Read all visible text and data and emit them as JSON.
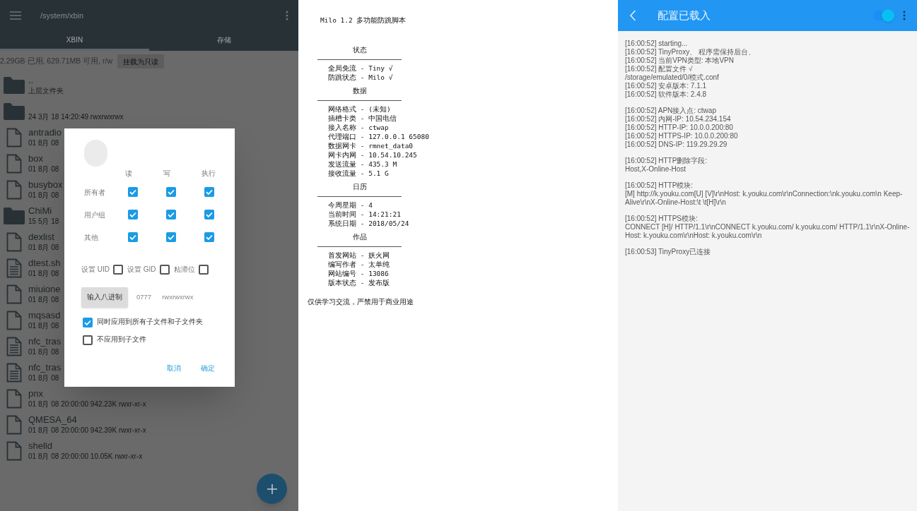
{
  "file_manager": {
    "path": "/system/xbin",
    "tabs": [
      {
        "label": "XBIN",
        "selected": true
      },
      {
        "label": "存储",
        "selected": false
      }
    ],
    "storage_info": "2.29GB 已用, 629.71MB 可用, r/w",
    "mount_button": "挂载为只读",
    "files": [
      {
        "kind": "folder",
        "name": "..",
        "meta": "上层文件夹"
      },
      {
        "kind": "folder",
        "meta": "24 3月 18 14:20:49  rwxrwxrwx"
      },
      {
        "kind": "file",
        "name": "antradio",
        "meta": "01 8月 08"
      },
      {
        "kind": "file",
        "name": "box",
        "meta": "01 8月 08"
      },
      {
        "kind": "file",
        "name": "busybox",
        "meta": "01 8月 08"
      },
      {
        "kind": "folder",
        "name": "ChiMi",
        "meta": "15 5月 18"
      },
      {
        "kind": "file",
        "name": "dexlist",
        "meta": "01 8月 08"
      },
      {
        "kind": "script",
        "name": "dtest.sh",
        "meta": "01 8月 08"
      },
      {
        "kind": "file",
        "name": "miuione",
        "meta": "01 8月 08"
      },
      {
        "kind": "file",
        "name": "mqsasd",
        "meta": "01 8月 08"
      },
      {
        "kind": "script",
        "name": "nfc_tras",
        "meta": "01 8月 08"
      },
      {
        "kind": "script",
        "name": "nfc_tras",
        "meta": "01 8月 08"
      },
      {
        "kind": "file",
        "name": "pnx",
        "meta": "01 8月 08 20:00:00  942.23K  rwxr-xr-x"
      },
      {
        "kind": "file",
        "name": "QMESA_64",
        "meta": "01 8月 08 20:00:00  942.39K  rwxr-xr-x"
      },
      {
        "kind": "file",
        "name": "shelld",
        "meta": "01 8月 08 20:00:00  10.05K  rwxr-xr-x"
      }
    ],
    "dialog": {
      "columns": [
        "读",
        "写",
        "执行"
      ],
      "rows": [
        {
          "label": "所有者",
          "checks": [
            true,
            true,
            true
          ]
        },
        {
          "label": "用户组",
          "checks": [
            true,
            true,
            true
          ]
        },
        {
          "label": "其他",
          "checks": [
            true,
            true,
            true
          ]
        }
      ],
      "special": [
        {
          "label": "设置 UID",
          "checked": false
        },
        {
          "label": "设置 GID",
          "checked": false
        },
        {
          "label": "粘滞位",
          "checked": false
        }
      ],
      "octal_button": "输入八进制",
      "octal": "0777",
      "symbolic": "rwxrwxrwx",
      "options": [
        {
          "label": "同时应用到所有子文件和子文件夹",
          "checked": true
        },
        {
          "label": "不应用到子文件",
          "checked": false
        }
      ],
      "buttons": [
        "取消",
        "确定"
      ]
    }
  },
  "script_output": {
    "title": "Milo 1.2 多功能防跳脚本",
    "sections": [
      {
        "heading": "状态",
        "items": [
          "全局免流 - Tiny √",
          "防跳状态 - Milo √"
        ]
      },
      {
        "heading": "数据",
        "items": [
          "网络格式 - (未知)",
          "插槽卡类 - 中国电信",
          "接入名称 - ctwap",
          "代理端口 - 127.0.0.1 65080",
          "数据网卡 - rmnet_data0",
          "网卡内网 - 10.54.10.245",
          "发送流量 - 435.3 M",
          "接收流量 - 5.1 G"
        ]
      },
      {
        "heading": "日历",
        "items": [
          "今周星期 - 4",
          "当前时间 - 14:21:21",
          "系统日期 - 2018/05/24"
        ]
      },
      {
        "heading": "作品",
        "items": [
          "首发网站 - 妖火网",
          "编写作者 - 太单纯",
          "网站编号 - 13086",
          "版本状态 - 发布版"
        ]
      }
    ],
    "footer": "仅供学习交流，严禁用于商业用途"
  },
  "proxy_app": {
    "title": "配置已载入",
    "switch_on": true,
    "log": [
      [
        "[16:00:52] starting...",
        "[16:00:52] TinyProxy、 程序需保持后台、",
        "[16:00:52] 当前VPN类型: 本地VPN",
        "[16:00:52] 配置文件 √",
        "/storage/emulated/0/模式.conf",
        "[16:00:52] 安卓版本: 7.1.1",
        "[16:00:52] 软件版本: 2.4.8"
      ],
      [
        "[16:00:52] APN接入点: ctwap",
        "[16:00:52] 内网-IP: 10.54.234.154",
        "[16:00:52] HTTP-IP: 10.0.0.200:80",
        "[16:00:52] HTTPS-IP: 10.0.0.200:80",
        "[16:00:52] DNS-IP: 119.29.29.29"
      ],
      [
        "[16:00:52] HTTP删除字段:",
        "Host,X-Online-Host"
      ],
      [
        "[16:00:52] HTTP模块:",
        "[M] http://k.youku.com[U] [V]\\r\\nHost: k.youku.com\\r\\nConnection:\\nk.youku.com\\n  Keep-Alive\\r\\nX-Online-Host:\\t \\t[H]\\r\\n"
      ],
      [
        "[16:00:52] HTTPS模块:",
        "CONNECT [H]/ HTTP/1.1\\r\\nCONNECT k.youku.com/ k.youku.com/ HTTP/1.1\\r\\nX-Online-Host: k.youku.com\\r\\nHost: k.youku.com\\r\\n"
      ],
      [
        "[16:00:53] TinyProxy已连接"
      ]
    ]
  }
}
